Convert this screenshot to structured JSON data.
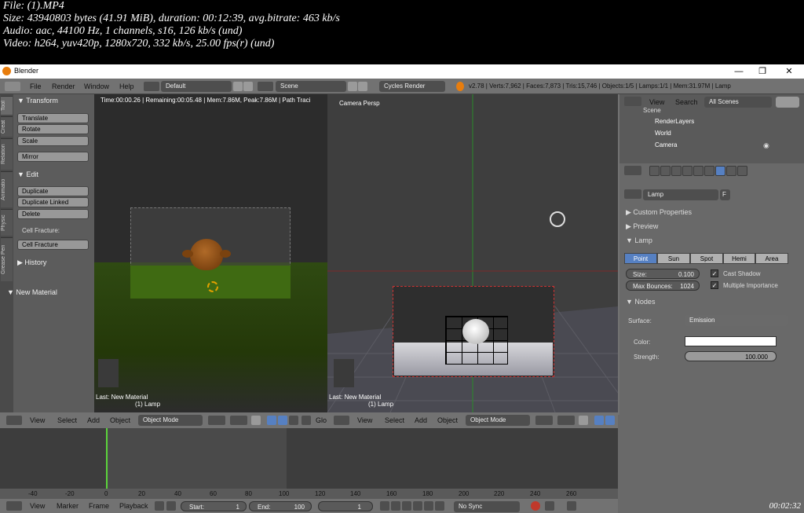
{
  "media_info": {
    "line1": "File:  (1).MP4",
    "line2": "Size: 43940803 bytes (41.91 MiB), duration: 00:12:39, avg.bitrate: 463 kb/s",
    "line3": "Audio: aac, 44100 Hz, 1 channels, s16, 126 kb/s (und)",
    "line4": "Video: h264, yuv420p, 1280x720, 332 kb/s, 25.00 fps(r) (und)",
    "timestamp": "00:02:32"
  },
  "window": {
    "title": "Blender",
    "minimize": "—",
    "maximize": "❐",
    "close": "✕"
  },
  "top_header": {
    "menus": [
      "File",
      "Render",
      "Window",
      "Help"
    ],
    "layout": "Default",
    "scene": "Scene",
    "engine": "Cycles Render",
    "stats": "v2.78 | Verts:7,962 | Faces:7,873 | Tris:15,746 | Objects:1/5 | Lamps:1/1 | Mem:31.97M | Lamp"
  },
  "toolshelf": {
    "tabs": [
      "Tool",
      "Creat",
      "Relation",
      "Animatio",
      "Physic",
      "Grease Pen"
    ],
    "transform_title": "Transform",
    "transform_buttons": [
      "Translate",
      "Rotate",
      "Scale",
      "Mirror"
    ],
    "edit_title": "Edit",
    "edit_buttons": [
      "Duplicate",
      "Duplicate Linked",
      "Delete"
    ],
    "cell_fracture_label": "Cell Fracture:",
    "cell_fracture_button": "Cell Fracture",
    "history_title": "History",
    "new_material_title": "New Material"
  },
  "viewport_left": {
    "render_info": "Time:00:00.26 | Remaining:00:05.48 | Mem:7.86M, Peak:7.86M | Path Traci",
    "last_op": "Last: New Material",
    "object": "(1) Lamp"
  },
  "viewport_right": {
    "label": "Camera Persp",
    "last_op": "Last: New Material",
    "object": "(1) Lamp"
  },
  "viewport_header": {
    "menus": [
      "View",
      "Select",
      "Add",
      "Object"
    ],
    "mode": "Object Mode",
    "global": "Glo"
  },
  "outliner": {
    "menus": [
      "View",
      "Search"
    ],
    "filter": "All Scenes",
    "items": [
      "Scene",
      "RenderLayers",
      "World",
      "Camera"
    ]
  },
  "properties": {
    "object_name": "Lamp",
    "fake_user": "F",
    "sections": {
      "custom_properties": "Custom Properties",
      "preview": "Preview",
      "lamp": "Lamp",
      "nodes": "Nodes"
    },
    "lamp_types": [
      "Point",
      "Sun",
      "Spot",
      "Hemi",
      "Area"
    ],
    "size_label": "Size:",
    "size_value": "0.100",
    "bounces_label": "Max Bounces:",
    "bounces_value": "1024",
    "cast_shadow": "Cast Shadow",
    "multiple_importance": "Multiple Importance",
    "surface_label": "Surface:",
    "surface_value": "Emission",
    "color_label": "Color:",
    "strength_label": "Strength:",
    "strength_value": "100.000"
  },
  "timeline": {
    "ticks": [
      "-40",
      "-20",
      "0",
      "20",
      "40",
      "60",
      "80",
      "100",
      "120",
      "140",
      "160",
      "180",
      "200",
      "220",
      "240",
      "260"
    ],
    "menus": [
      "View",
      "Marker",
      "Frame",
      "Playback"
    ],
    "start_label": "Start:",
    "start_value": "1",
    "end_label": "End:",
    "end_value": "100",
    "current_frame": "1",
    "sync": "No Sync"
  },
  "colors": {
    "accent": "#5680c2",
    "panel": "#727272",
    "viewport": "#3e3e3e",
    "grass": "#3f6a12",
    "monkey": "#8a4a14"
  }
}
